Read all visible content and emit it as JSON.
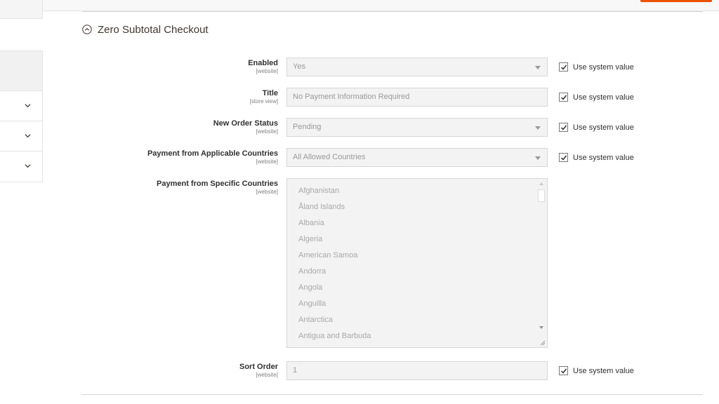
{
  "section": {
    "title": "Zero Subtotal Checkout"
  },
  "fields": {
    "enabled": {
      "label": "Enabled",
      "scope": "[website]",
      "value": "Yes",
      "use_system": "Use system value"
    },
    "title": {
      "label": "Title",
      "scope": "[store view]",
      "value": "No Payment Information Required",
      "use_system": "Use system value"
    },
    "new_order_status": {
      "label": "New Order Status",
      "scope": "[website]",
      "value": "Pending",
      "use_system": "Use system value"
    },
    "applicable_countries": {
      "label": "Payment from Applicable Countries",
      "scope": "[website]",
      "value": "All Allowed Countries",
      "use_system": "Use system value"
    },
    "specific_countries": {
      "label": "Payment from Specific Countries",
      "scope": "[website]",
      "options": [
        "Afghanistan",
        "Åland Islands",
        "Albania",
        "Algeria",
        "American Samoa",
        "Andorra",
        "Angola",
        "Anguilla",
        "Antarctica",
        "Antigua and Barbuda"
      ]
    },
    "sort_order": {
      "label": "Sort Order",
      "scope": "[website]",
      "value": "1",
      "use_system": "Use system value"
    }
  },
  "colors": {
    "accent": "#eb5202",
    "disabled_bg": "#f3f3f3",
    "disabled_text": "#999999"
  },
  "icons": {
    "section_toggle": "collapse-circle-icon",
    "sidebar_chevron": "chevron-down-icon",
    "select_arrow": "caret-down-icon",
    "checkbox_mark": "checkmark-icon"
  }
}
